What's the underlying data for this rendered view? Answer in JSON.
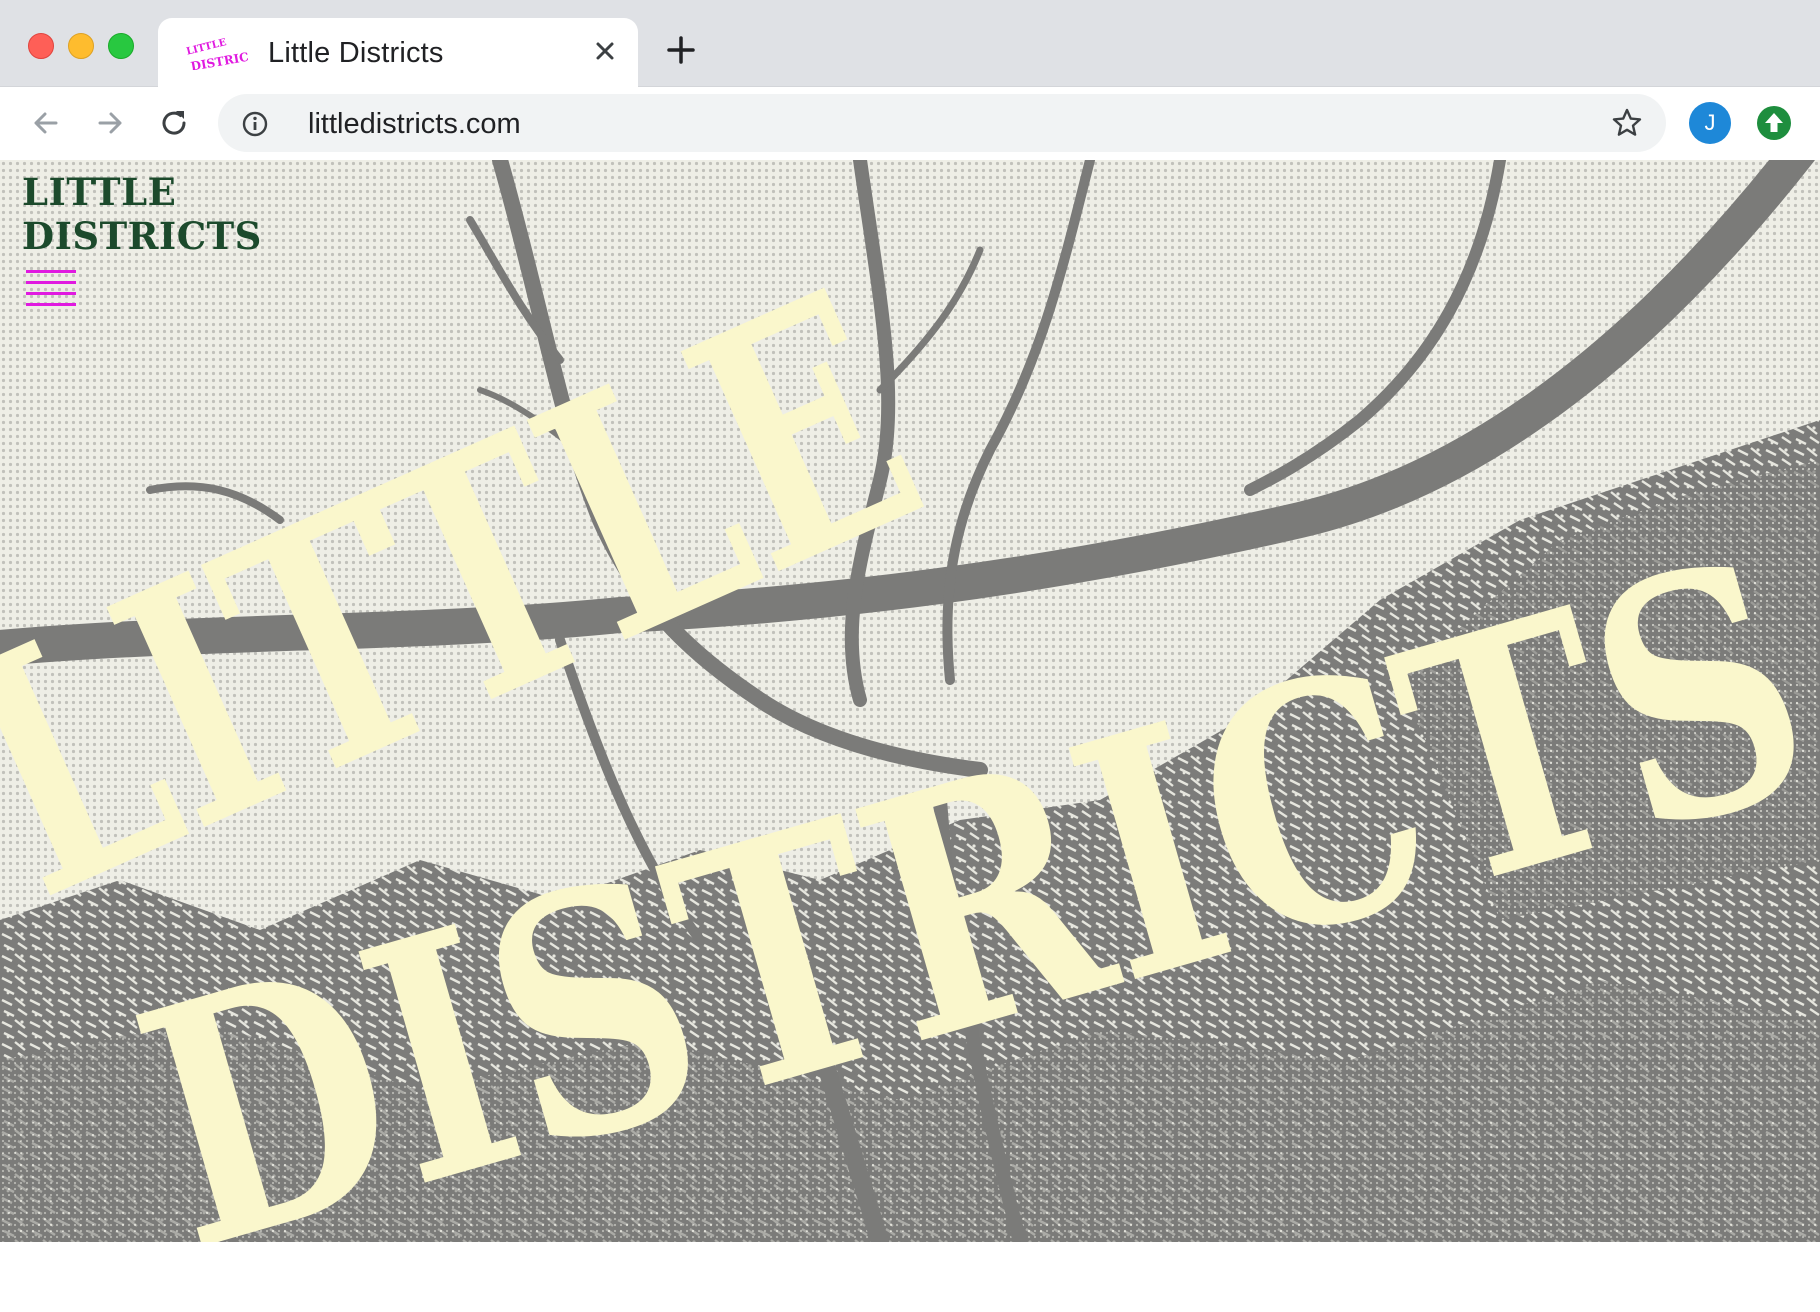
{
  "browser": {
    "tab": {
      "title": "Little Districts",
      "favicon_text": [
        "LITTLE",
        "DISTRICTS"
      ],
      "favicon_color": "#e01ae0"
    },
    "address_bar": {
      "url": "littledistricts.com"
    },
    "profile": {
      "initial": "J",
      "color": "#1e88d8"
    },
    "icons": {
      "back": "arrow-left-icon",
      "forward": "arrow-right-icon",
      "reload": "reload-icon",
      "info": "info-icon",
      "bookmark": "star-icon",
      "close_tab": "close-icon",
      "new_tab": "plus-icon",
      "update": "arrow-up-icon"
    },
    "update_color": "#1e8e3e"
  },
  "site": {
    "logo_lines": [
      "LITTLE",
      "DISTRICTS"
    ],
    "logo_color": "#1c4a2c",
    "menu_icon": "hamburger-menu-icon",
    "menu_color": "#e01ae0",
    "hero": {
      "headline_words": [
        "LITTLE",
        "DISTRICTS"
      ],
      "headline_color": "#faf7cc",
      "photo_tone": "#7a7a78"
    }
  }
}
